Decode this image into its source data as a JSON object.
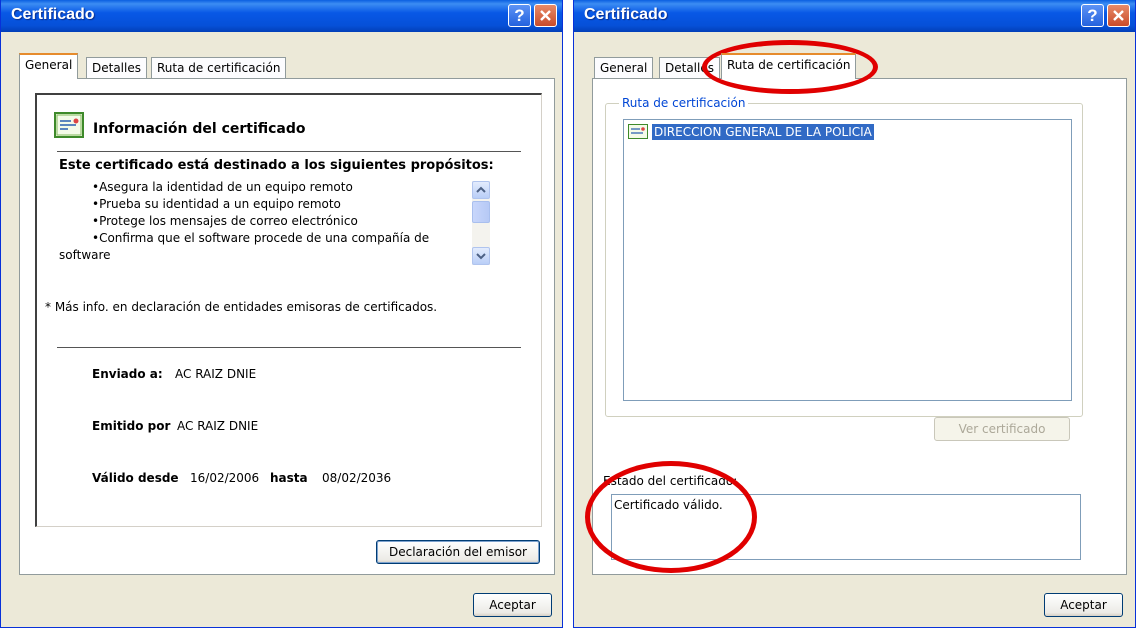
{
  "left_dialog": {
    "title": "Certificado",
    "tabs": [
      "General",
      "Detalles",
      "Ruta de certificación"
    ],
    "info_heading": "Información del certificado",
    "purposes_heading": "Este certificado está destinado a los siguientes propósitos:",
    "purposes": [
      "•Asegura la identidad de un equipo remoto",
      "•Prueba su identidad a un equipo remoto",
      "•Protege los mensajes de correo electrónico",
      "•Confirma que el software procede de una compañía de",
      "software"
    ],
    "note": "* Más info. en declaración de entidades emisoras de certificados.",
    "issued_to_label": "Enviado a:",
    "issued_to_value": "AC RAIZ DNIE",
    "issued_by_label": "Emitido por",
    "issued_by_value": "AC RAIZ DNIE",
    "valid_from_label": "Válido desde",
    "valid_from_value": "16/02/2006",
    "valid_to_label": "hasta",
    "valid_to_value": "08/02/2036",
    "issuer_statement_button": "Declaración del emisor",
    "ok_button": "Aceptar"
  },
  "right_dialog": {
    "title": "Certificado",
    "tabs": [
      "General",
      "Detalles",
      "Ruta de certificación"
    ],
    "path_group_label": "Ruta de certificación",
    "path_items": [
      "DIRECCION GENERAL DE LA POLICIA"
    ],
    "view_certificate_button": "Ver certificado",
    "status_label": "Estado del certificado:",
    "status_value": "Certificado válido.",
    "ok_button": "Aceptar"
  },
  "help_glyph": "?",
  "colors": {
    "annotation": "#e00000",
    "selection": "#316ac5",
    "titlebar": "#0858e6"
  }
}
